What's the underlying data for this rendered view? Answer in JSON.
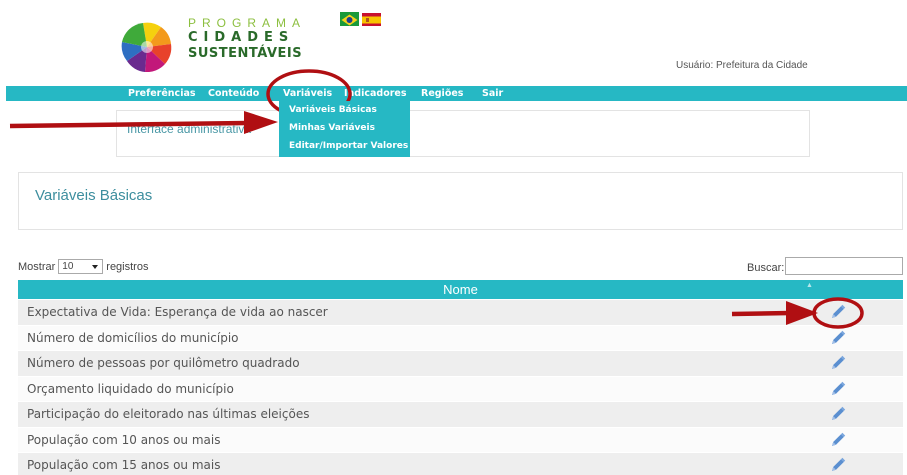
{
  "header": {
    "logo_line1": "PROGRAMA",
    "logo_line2": "CIDADES",
    "logo_line3": "SUSTENTÁVEIS",
    "user_text": "Usuário: Prefeitura da Cidade"
  },
  "nav": {
    "items": [
      {
        "label": "Preferências"
      },
      {
        "label": "Conteúdo"
      },
      {
        "label": "Variáveis"
      },
      {
        "label": "Indicadores"
      },
      {
        "label": "Regiões"
      },
      {
        "label": "Sair"
      }
    ],
    "dropdown": [
      {
        "label": "Variáveis Básicas"
      },
      {
        "label": "Minhas Variáveis"
      },
      {
        "label": "Editar/Importar Valores"
      }
    ]
  },
  "admin_text": "Interface administrativa",
  "page_title": "Variáveis Básicas",
  "controls": {
    "show_label": "Mostrar",
    "page_size": "10",
    "records_label": "registros",
    "search_label": "Buscar:"
  },
  "table": {
    "header": "Nome",
    "rows": [
      {
        "name": "Expectativa de Vida: Esperança de vida ao nascer"
      },
      {
        "name": "Número de domicílios do município"
      },
      {
        "name": "Número de pessoas por quilômetro quadrado"
      },
      {
        "name": "Orçamento liquidado do município"
      },
      {
        "name": "Participação do eleitorado nas últimas eleições"
      },
      {
        "name": "População com 10 anos ou mais"
      },
      {
        "name": "População com 15 anos ou mais"
      }
    ]
  },
  "colors": {
    "accent": "#26b8c4",
    "annotation": "#b00f12"
  }
}
